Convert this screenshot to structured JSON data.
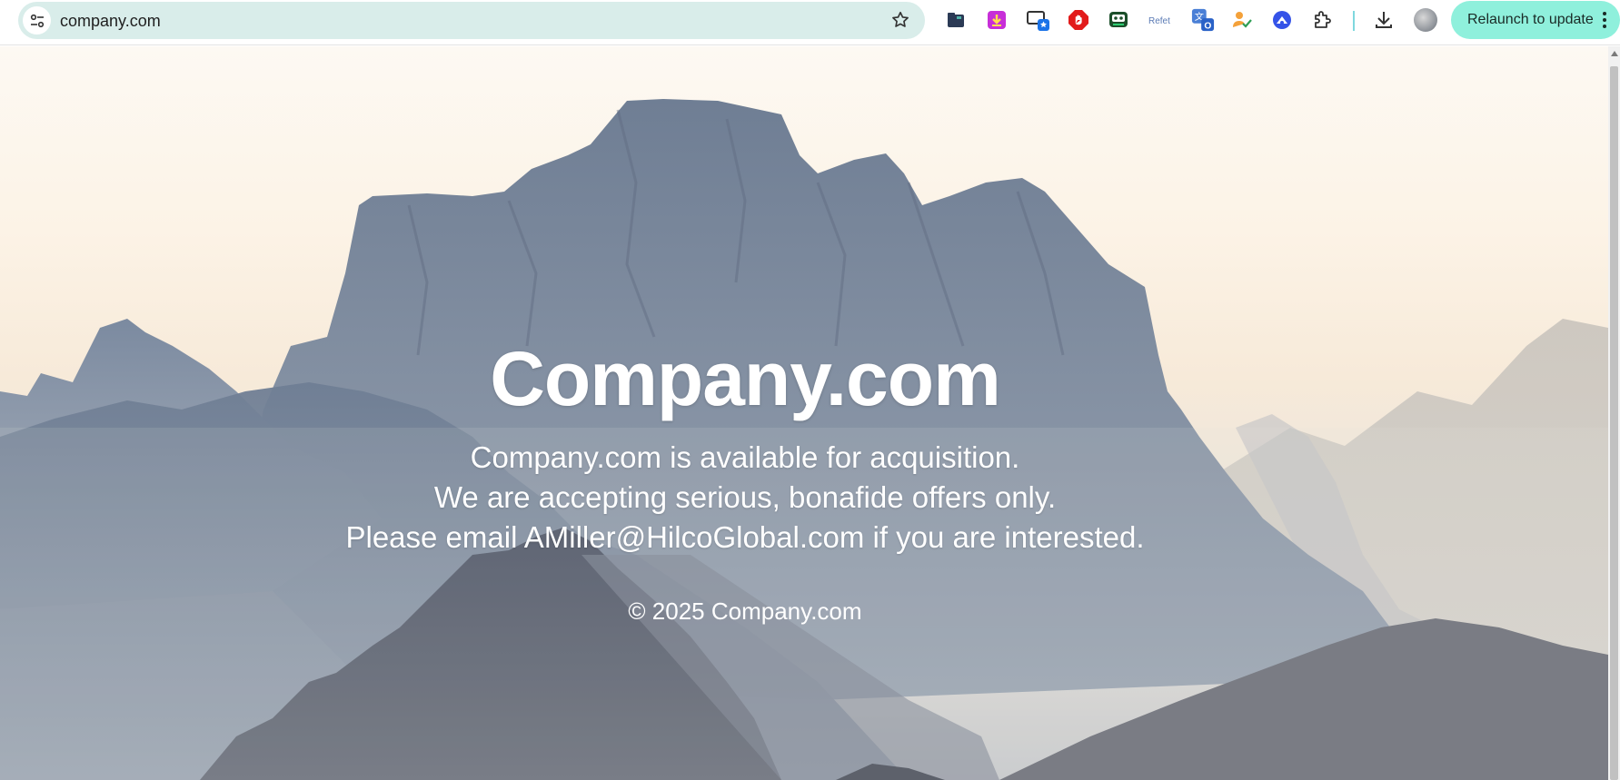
{
  "browser": {
    "url": "company.com",
    "relaunch_label": "Relaunch to update",
    "extensions": [
      "folder-extension-icon",
      "download-extension-icon",
      "screen-capture-icon",
      "adblock-icon",
      "robot-extension-icon",
      "bookmark-extension-icon",
      "translate-icon",
      "profile-check-icon",
      "vpn-extension-icon",
      "puzzle-icon"
    ]
  },
  "hero": {
    "title": "Company.com",
    "lines": [
      "Company.com is available for acquisition.",
      "We are accepting serious, bonafide offers only.",
      "Please email AMiller@HilcoGlobal.com if you are interested."
    ],
    "copyright": "© 2025 Company.com"
  },
  "colors": {
    "omnibox_bg": "#d9edea",
    "relaunch_bg": "#8ff0dc",
    "hero_text": "#ffffff"
  }
}
